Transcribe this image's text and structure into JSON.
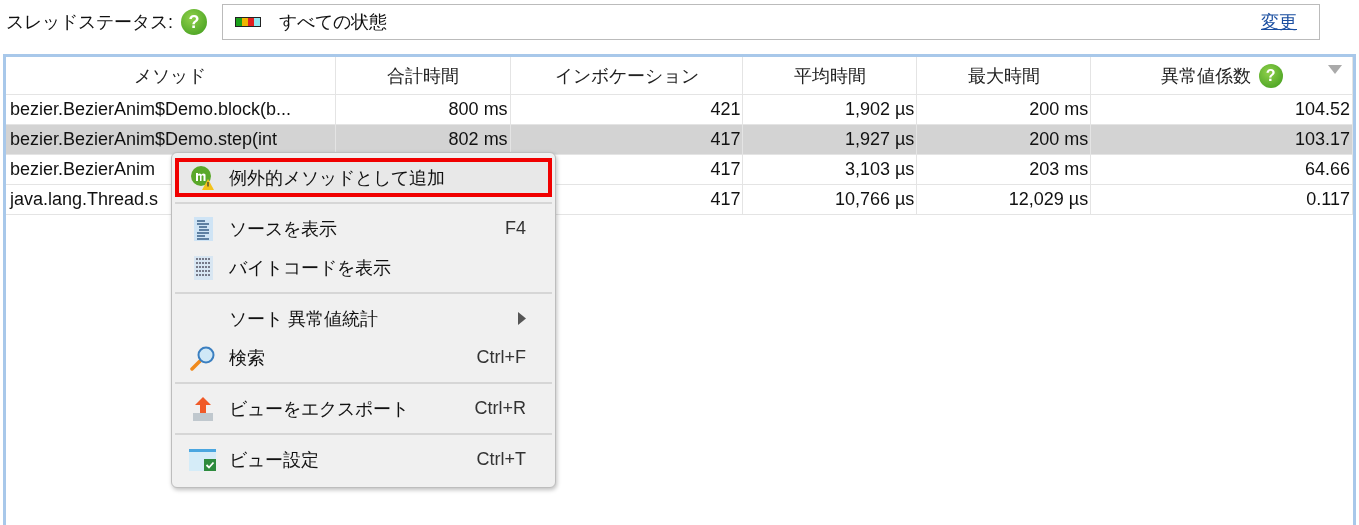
{
  "thread_status": {
    "label": "スレッドステータス:",
    "help_glyph": "?",
    "value": "すべての状態",
    "change_link": "変更"
  },
  "table": {
    "columns": [
      {
        "label": "メソッド",
        "sorted": false
      },
      {
        "label": "合計時間",
        "sorted": false
      },
      {
        "label": "インボケーション",
        "sorted": false
      },
      {
        "label": "平均時間",
        "sorted": false
      },
      {
        "label": "最大時間",
        "sorted": false
      },
      {
        "label": "異常値係数",
        "sorted": true,
        "help_glyph": "?"
      }
    ],
    "rows": [
      {
        "selected": false,
        "cells": [
          "bezier.BezierAnim$Demo.block(b...",
          "800 ms",
          "421",
          "1,902 µs",
          "200 ms",
          "104.52"
        ]
      },
      {
        "selected": true,
        "cells": [
          "bezier.BezierAnim$Demo.step(int",
          "802 ms",
          "417",
          "1,927 µs",
          "200 ms",
          "103.17"
        ]
      },
      {
        "selected": false,
        "cells": [
          "bezier.BezierAnim",
          "",
          "417",
          "3,103 µs",
          "203 ms",
          "64.66"
        ]
      },
      {
        "selected": false,
        "cells": [
          "java.lang.Thread.s",
          "",
          "417",
          "10,766 µs",
          "12,029 µs",
          "0.117"
        ]
      }
    ]
  },
  "context_menu": {
    "items": [
      {
        "kind": "item",
        "label": "例外的メソッドとして追加",
        "highlighted": true
      },
      {
        "kind": "separator"
      },
      {
        "kind": "item",
        "label": "ソースを表示",
        "shortcut": "F4",
        "highlighted": false
      },
      {
        "kind": "item",
        "label": "バイトコードを表示",
        "highlighted": false
      },
      {
        "kind": "separator"
      },
      {
        "kind": "item",
        "label": "ソート 異常値統計",
        "submenu": true,
        "highlighted": false
      },
      {
        "kind": "item",
        "label": "検索",
        "shortcut": "Ctrl+F",
        "highlighted": false
      },
      {
        "kind": "separator"
      },
      {
        "kind": "item",
        "label": "ビューをエクスポート",
        "shortcut": "Ctrl+R",
        "highlighted": false
      },
      {
        "kind": "separator"
      },
      {
        "kind": "item",
        "label": "ビュー設定",
        "shortcut": "Ctrl+T",
        "highlighted": false
      }
    ]
  }
}
